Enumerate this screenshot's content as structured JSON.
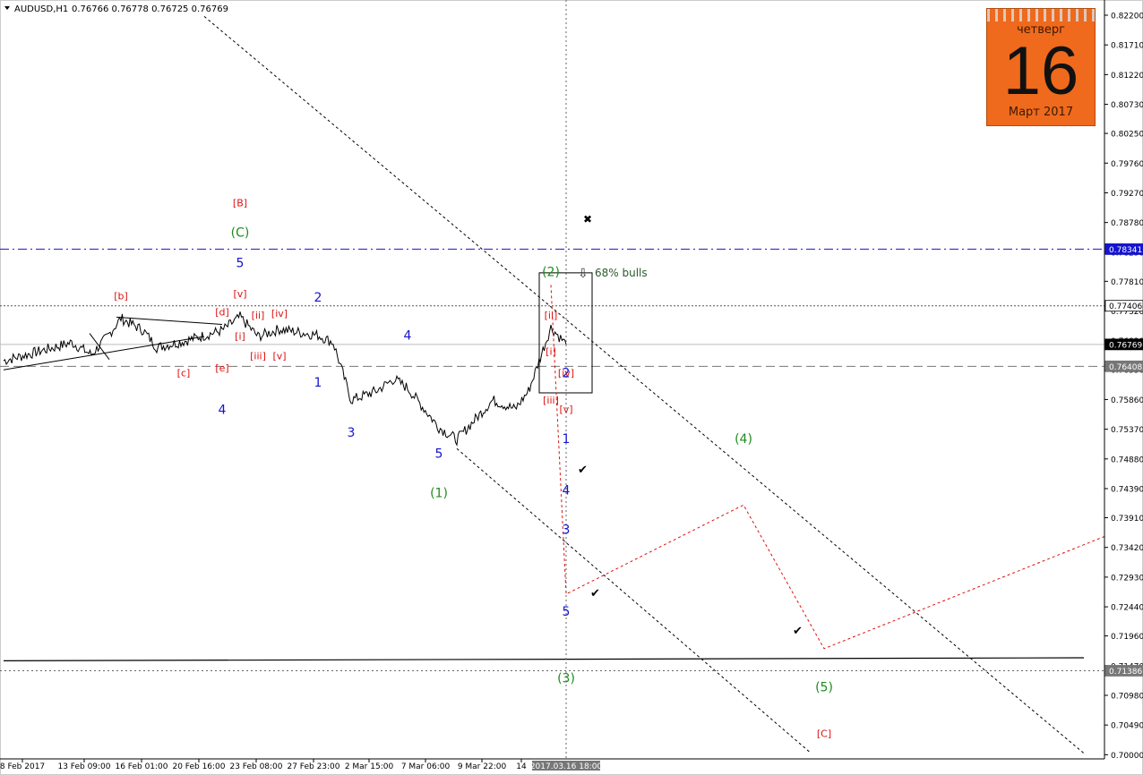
{
  "header": {
    "symbol": "AUDUSD,H1",
    "ohlc": "0.76766 0.76778 0.76725 0.76769"
  },
  "calendar": {
    "weekday": "четверг",
    "day": "16",
    "month_year": "Март 2017"
  },
  "annotation": {
    "bulls": "68% bulls"
  },
  "colors": {
    "red": "#dd1111",
    "green": "#1f8c1f",
    "blue": "#1515cc",
    "black": "#000000",
    "bg": "#ffffff"
  },
  "chart_data": {
    "type": "line",
    "ylim": [
      0.7002,
      0.822
    ],
    "y_ticks": [
      "0.82200",
      "0.81710",
      "0.81220",
      "0.80730",
      "0.80250",
      "0.79760",
      "0.79270",
      "0.78780",
      "0.78290",
      "0.77810",
      "0.77320",
      "0.76830",
      "0.76350",
      "0.75860",
      "0.75370",
      "0.74880",
      "0.74390",
      "0.73910",
      "0.73420",
      "0.72930",
      "0.72440",
      "0.71960",
      "0.71470",
      "0.70980",
      "0.70490",
      "0.70000"
    ],
    "x_ticks": [
      "8 Feb 2017",
      "13 Feb 09:00",
      "16 Feb 01:00",
      "20 Feb 16:00",
      "23 Feb 08:00",
      "27 Feb 23:00",
      "2 Mar 15:00",
      "7 Mar 06:00",
      "9 Mar 22:00",
      "14"
    ],
    "x_highlight": "2017.03.16 18:00",
    "price_tags": [
      {
        "text": "0.78341",
        "value": 0.78341,
        "style": "blue"
      },
      {
        "text": "0.77406",
        "value": 0.77406,
        "style": "white"
      },
      {
        "text": "0.76769",
        "value": 0.76769,
        "style": "black"
      },
      {
        "text": "0.76408",
        "value": 0.76408,
        "style": "gray"
      },
      {
        "text": "0.71386",
        "value": 0.71386,
        "style": "gray"
      }
    ],
    "price_path": [
      [
        "8 Feb 2017",
        0.765
      ],
      [
        "10 Feb 2017",
        0.766
      ],
      [
        "11 Feb 2017",
        0.767
      ],
      [
        "13 Feb 09:00",
        0.768
      ],
      [
        "14 Feb 2017",
        0.766
      ],
      [
        "15 Feb 2017",
        0.769
      ],
      [
        "16 Feb 01:00",
        0.772
      ],
      [
        "17 Feb 2017",
        0.77
      ],
      [
        "18 Feb 2017",
        0.7672
      ],
      [
        "20 Feb 16:00",
        0.7682
      ],
      [
        "22 Feb 2017",
        0.77
      ],
      [
        "23 Feb 08:00",
        0.7722
      ],
      [
        "24 Feb 2017",
        0.769
      ],
      [
        "25 Feb 2017",
        0.7702
      ],
      [
        "27 Feb 23:00",
        0.7692
      ],
      [
        "1 Mar 2017",
        0.768
      ],
      [
        "2 Mar 15:00",
        0.7585
      ],
      [
        "5 Mar 2017",
        0.76
      ],
      [
        "6 Mar 2017",
        0.762
      ],
      [
        "7 Mar 06:00",
        0.7605
      ],
      [
        "8 Mar 2017",
        0.754
      ],
      [
        "9 Mar 22:00",
        0.752
      ],
      [
        "11 Mar 2017",
        0.7585
      ],
      [
        "13 Mar 2017",
        0.757
      ],
      [
        "14",
        0.76
      ],
      [
        "15 Mar 2017",
        0.7705
      ],
      [
        "16 Mar 2017",
        0.7677
      ]
    ],
    "projection_path": [
      [
        "15 Mar 2017",
        0.7775
      ],
      [
        "16 Mar 2017",
        0.7265
      ],
      [
        "20 Mar 2017",
        0.7412
      ],
      [
        "23 Mar 2017",
        0.7175
      ],
      [
        "30 Mar 2017",
        0.736
      ]
    ],
    "wave_labels": [
      {
        "text": "[B]",
        "color": "red",
        "x": "23 Feb 08:00",
        "y": 0.7912
      },
      {
        "text": "(C)",
        "color": "green",
        "x": "23 Feb 08:00",
        "y": 0.7862
      },
      {
        "text": "5",
        "color": "blue",
        "x": "23 Feb 08:00",
        "y": 0.7812
      },
      {
        "text": "[b]",
        "color": "red",
        "x": "16 Feb 01:00",
        "y": 0.7759
      },
      {
        "text": "[v]",
        "color": "red",
        "x": "23 Feb 08:00",
        "y": 0.7762
      },
      {
        "text": "[d]",
        "color": "red",
        "x": "22 Feb 2017",
        "y": 0.7732
      },
      {
        "text": "[ii]",
        "color": "red",
        "x": "24 Feb 2017",
        "y": 0.7727
      },
      {
        "text": "[iv]",
        "color": "red",
        "x": "25 Feb 2017",
        "y": 0.773
      },
      {
        "text": "2",
        "color": "blue",
        "x": "27 Feb 23:00",
        "y": 0.7755
      },
      {
        "text": "[i]",
        "color": "red",
        "x": "23 Feb 08:00",
        "y": 0.7692
      },
      {
        "text": "[iii]",
        "color": "red",
        "x": "24 Feb 2017",
        "y": 0.766
      },
      {
        "text": "[v]",
        "color": "red",
        "x": "25 Feb 2017",
        "y": 0.766
      },
      {
        "text": "[e]",
        "color": "red",
        "x": "22 Feb 2017",
        "y": 0.764
      },
      {
        "text": "[c]",
        "color": "red",
        "x": "20 Feb 16:00",
        "y": 0.7632
      },
      {
        "text": "4",
        "color": "blue",
        "x": "7 Mar 06:00",
        "y": 0.7692
      },
      {
        "text": "1",
        "color": "blue",
        "x": "27 Feb 23:00",
        "y": 0.7615
      },
      {
        "text": "4",
        "color": "blue",
        "x": "22 Feb 2017",
        "y": 0.757
      },
      {
        "text": "3",
        "color": "blue",
        "x": "2 Mar 15:00",
        "y": 0.7532
      },
      {
        "text": "5",
        "color": "blue",
        "x": "8 Mar 2017",
        "y": 0.7497
      },
      {
        "text": "(1)",
        "color": "green",
        "x": "8 Mar 2017",
        "y": 0.7432
      },
      {
        "text": "(2)",
        "color": "green",
        "x": "15 Mar 2017",
        "y": 0.7797
      },
      {
        "text": "[ii]",
        "color": "red",
        "x": "15 Mar 2017",
        "y": 0.7727
      },
      {
        "text": "[i]",
        "color": "red",
        "x": "15 Mar 2017",
        "y": 0.7667
      },
      {
        "text": "[iv]",
        "color": "red",
        "x": "16 Mar 2017",
        "y": 0.7632
      },
      {
        "text": "2",
        "color": "blue",
        "x": "16 Mar 2017",
        "y": 0.763
      },
      {
        "text": "[iii]",
        "color": "red",
        "x": "15 Mar 2017",
        "y": 0.7587
      },
      {
        "text": "[v]",
        "color": "red",
        "x": "16 Mar 2017",
        "y": 0.7572
      },
      {
        "text": "1",
        "color": "blue",
        "x": "16 Mar 2017",
        "y": 0.7522
      },
      {
        "text": "4",
        "color": "blue",
        "x": "16 Mar 2017",
        "y": 0.7437
      },
      {
        "text": "3",
        "color": "blue",
        "x": "16 Mar 2017",
        "y": 0.7372
      },
      {
        "text": "5",
        "color": "blue",
        "x": "16 Mar 2017",
        "y": 0.7237
      },
      {
        "text": "(4)",
        "color": "green",
        "x": "20 Mar 2017",
        "y": 0.7522
      },
      {
        "text": "(3)",
        "color": "green",
        "x": "16 Mar 2017",
        "y": 0.7127
      },
      {
        "text": "(5)",
        "color": "green",
        "x": "23 Mar 2017",
        "y": 0.7112
      },
      {
        "text": "[C]",
        "color": "red",
        "x": "23 Mar 2017",
        "y": 0.7037
      }
    ]
  }
}
